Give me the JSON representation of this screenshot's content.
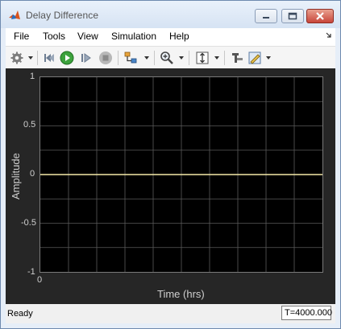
{
  "window": {
    "title": "Delay Difference"
  },
  "menu": {
    "items": [
      "File",
      "Tools",
      "View",
      "Simulation",
      "Help"
    ]
  },
  "toolbar": {
    "icons": [
      "gear-icon",
      "step-back-icon",
      "run-icon",
      "step-forward-icon",
      "stop-icon",
      "signal-select-icon",
      "zoom-icon",
      "fit-axes-icon",
      "data-cursor-icon",
      "highlight-icon"
    ]
  },
  "scope": {
    "y_ticks": [
      "1",
      "0.5",
      "0",
      "-0.5",
      "-1"
    ],
    "x_tick": "0",
    "ylabel": "Amplitude",
    "xlabel": "Time (hrs)"
  },
  "status": {
    "text": "Ready",
    "time": "T=4000.000"
  },
  "colors": {
    "plot_background": "#000000",
    "scope_background": "#262626",
    "grid": "#5a5a5a",
    "trace": "#f5e9a8"
  },
  "chart_data": {
    "type": "line",
    "ylim": [
      -1,
      1
    ],
    "grid": true,
    "series": [
      {
        "x": [
          0,
          10
        ],
        "values": [
          0,
          0
        ]
      }
    ],
    "ylabel": "Amplitude",
    "xlabel": "Time (hrs)"
  }
}
